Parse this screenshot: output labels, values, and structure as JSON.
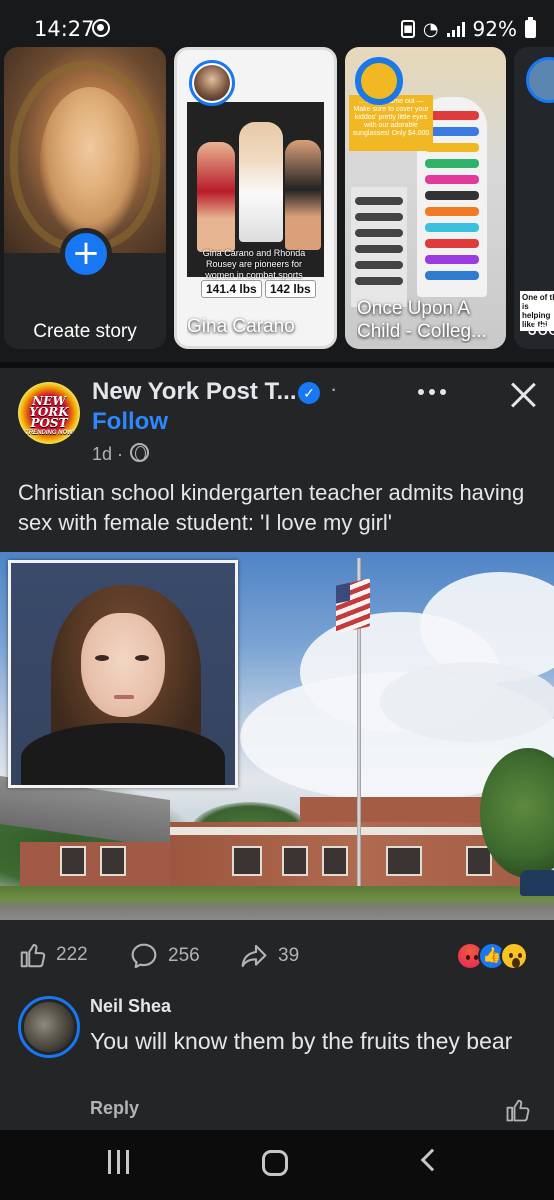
{
  "status_bar": {
    "time": "14:27",
    "battery": "92%"
  },
  "stories": [
    {
      "label": "Create story",
      "type": "create"
    },
    {
      "label": "Gina Carano",
      "weights": [
        "141.4 lbs",
        "142 lbs"
      ],
      "caption": "Gina Carano and Rhonda Rousey are pioneers for women in combat sports"
    },
    {
      "label": "Once Upon A Child - Colleg...",
      "note": "... finally came out — Make sure to cover your kiddos' pretty little eyes with our adorable sunglasses! Only $4.000"
    },
    {
      "label": "Joe",
      "peek_text": "One of th is helping like thi"
    }
  ],
  "post": {
    "page_name": "New York Post T...",
    "avatar_text": "NEW YORK POST",
    "avatar_subtext": "TRENDING NOW",
    "follow_label": "Follow",
    "time": "1d ·",
    "text": "Christian school kindergarten teacher admits having sex with female student: 'I love my girl'",
    "likes": "222",
    "comments": "256",
    "shares": "39"
  },
  "comment": {
    "author": "Neil Shea",
    "text": "You will know them by the fruits they bear",
    "reply_label": "Reply"
  },
  "colors": {
    "accent": "#1877f2",
    "background": "#242526",
    "text": "#e4e6eb",
    "muted": "#b0b3b8"
  }
}
